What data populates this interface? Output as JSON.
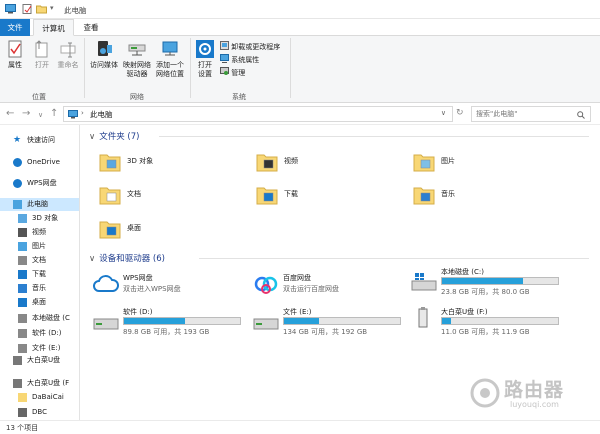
{
  "window": {
    "title": "此电脑"
  },
  "tabs": {
    "file": "文件",
    "computer": "计算机",
    "view": "查看"
  },
  "ribbon": {
    "location": {
      "group": "位置",
      "properties": "属性",
      "open": "打开",
      "rename": "重命名"
    },
    "network": {
      "group": "网络",
      "access_media": "访问媒体",
      "map_drive_1": "映射网络",
      "map_drive_2": "驱动器",
      "add_location_1": "添加一个",
      "add_location_2": "网络位置"
    },
    "system": {
      "group": "系统",
      "open_settings_1": "打开",
      "open_settings_2": "设置",
      "uninstall": "卸载或更改程序",
      "system_properties": "系统属性",
      "manage": "管理"
    }
  },
  "address": {
    "path": "此电脑",
    "search_placeholder": "搜索\"此电脑\""
  },
  "sidebar": {
    "items": [
      {
        "label": "快速访问",
        "icon": "star-icon"
      },
      {
        "label": "OneDrive",
        "icon": "cloud-icon"
      },
      {
        "label": "WPS网盘",
        "icon": "wps-cloud-icon"
      },
      {
        "label": "此电脑",
        "icon": "computer-icon",
        "selected": true
      },
      {
        "label": "3D 对象",
        "icon": "cube-icon"
      },
      {
        "label": "视频",
        "icon": "video-icon"
      },
      {
        "label": "图片",
        "icon": "picture-icon"
      },
      {
        "label": "文档",
        "icon": "document-icon"
      },
      {
        "label": "下载",
        "icon": "download-icon"
      },
      {
        "label": "音乐",
        "icon": "music-icon"
      },
      {
        "label": "桌面",
        "icon": "desktop-icon"
      },
      {
        "label": "本地磁盘 (C",
        "icon": "drive-icon"
      },
      {
        "label": "软件 (D:)",
        "icon": "drive-icon"
      },
      {
        "label": "文件 (E:)",
        "icon": "drive-icon"
      },
      {
        "label": "大白菜U盘",
        "icon": "usb-icon"
      },
      {
        "label": "大白菜U盘 (F",
        "icon": "usb-icon"
      },
      {
        "label": "DaBaiCai",
        "icon": "folder-icon"
      },
      {
        "label": "DBC",
        "icon": "gear-icon"
      }
    ]
  },
  "folders": {
    "header": "文件夹 (7)",
    "items": [
      "3D 对象",
      "视频",
      "图片",
      "文档",
      "下载",
      "音乐",
      "桌面"
    ]
  },
  "devices": {
    "header": "设备和驱动器 (6)",
    "items": [
      {
        "name": "WPS网盘",
        "sub": "双击进入WPS网盘",
        "type": "cloud"
      },
      {
        "name": "百度网盘",
        "sub": "双击运行百度网盘",
        "type": "baidu"
      },
      {
        "name": "本地磁盘 (C:)",
        "free": "23.8 GB 可用，共 80.0 GB",
        "used_fraction": 0.7,
        "type": "system"
      },
      {
        "name": "软件 (D:)",
        "free": "89.8 GB 可用，共 193 GB",
        "used_fraction": 0.53,
        "type": "drive"
      },
      {
        "name": "文件 (E:)",
        "free": "134 GB 可用，共 192 GB",
        "used_fraction": 0.3,
        "type": "drive"
      },
      {
        "name": "大白菜U盘 (F:)",
        "free": "11.0 GB 可用，共 11.9 GB",
        "used_fraction": 0.08,
        "type": "usb"
      }
    ]
  },
  "status": {
    "count": "13 个项目"
  },
  "watermark": {
    "name": "路由器",
    "domain": "luyouqi.com"
  },
  "colors": {
    "accent": "#1979ca",
    "folder": "#f8d775",
    "bar": "#26a0da"
  }
}
